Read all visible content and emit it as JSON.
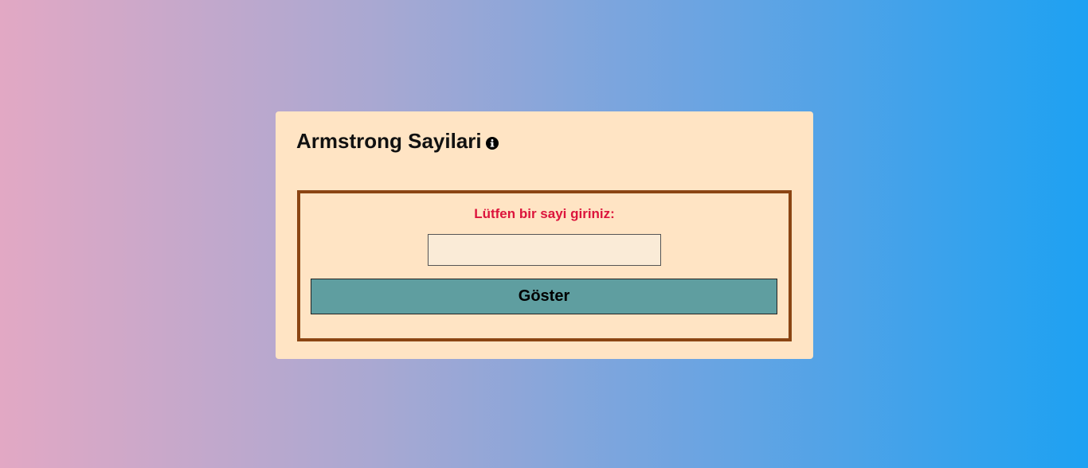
{
  "card": {
    "title": "Armstrong Sayilari",
    "info_icon": "info-circle-icon"
  },
  "form": {
    "prompt_label": "Lütfen bir sayi giriniz:",
    "input_value": "",
    "input_placeholder": "",
    "submit_label": "Göster"
  },
  "colors": {
    "card_background": "#ffe4c4",
    "form_border": "#8b4513",
    "prompt_color": "#dc143c",
    "input_background": "#faebd7",
    "button_background": "#5f9ea0"
  }
}
